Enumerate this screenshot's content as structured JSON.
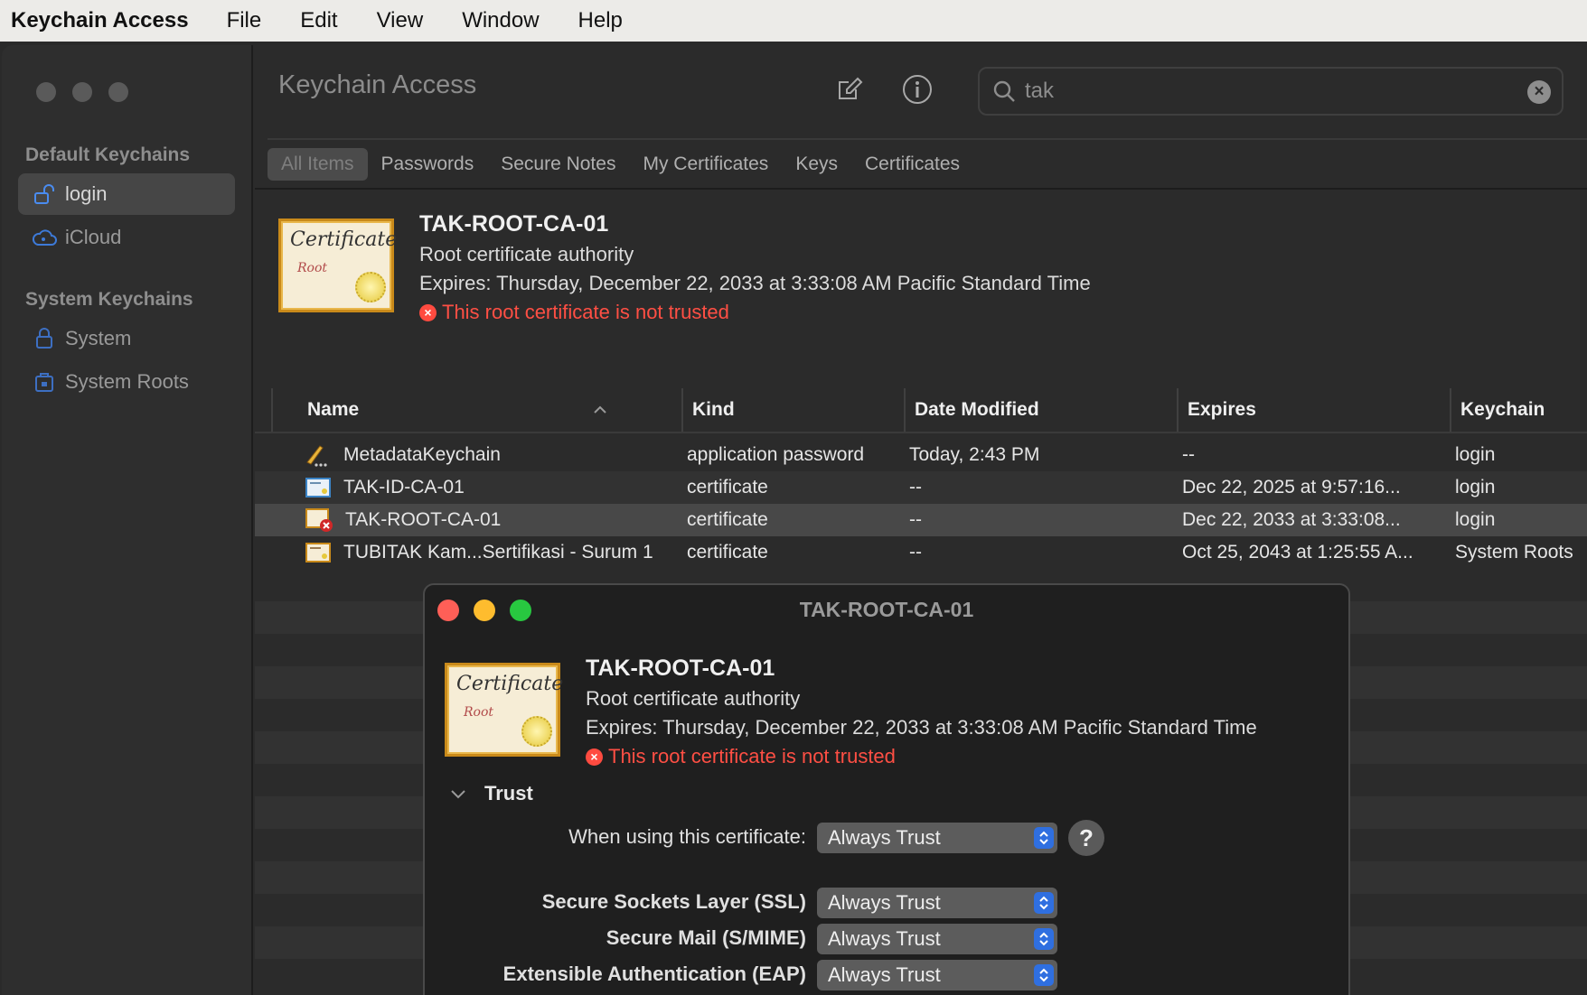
{
  "menubar": {
    "app_name": "Keychain Access",
    "items": [
      "File",
      "Edit",
      "View",
      "Window",
      "Help"
    ]
  },
  "sidebar": {
    "default_heading": "Default Keychains",
    "default_items": [
      {
        "label": "login",
        "icon": "unlocked-padlock-icon",
        "selected": true
      },
      {
        "label": "iCloud",
        "icon": "icloud-icon",
        "selected": false
      }
    ],
    "system_heading": "System Keychains",
    "system_items": [
      {
        "label": "System",
        "icon": "padlock-icon"
      },
      {
        "label": "System Roots",
        "icon": "cabinet-lock-icon"
      }
    ]
  },
  "toolbar": {
    "title": "Keychain Access",
    "search_value": "tak"
  },
  "tabs": [
    {
      "label": "All Items",
      "active": true
    },
    {
      "label": "Passwords",
      "active": false
    },
    {
      "label": "Secure Notes",
      "active": false
    },
    {
      "label": "My Certificates",
      "active": false
    },
    {
      "label": "Keys",
      "active": false
    },
    {
      "label": "Certificates",
      "active": false
    }
  ],
  "cert_icon_text": {
    "certificate": "Certificate",
    "root": "Root"
  },
  "summary": {
    "title": "TAK-ROOT-CA-01",
    "subtitle": "Root certificate authority",
    "expires": "Expires: Thursday, December 22, 2033 at 3:33:08 AM Pacific Standard Time",
    "warning": "This root certificate is not trusted"
  },
  "table": {
    "headers": [
      "Name",
      "Kind",
      "Date Modified",
      "Expires",
      "Keychain"
    ],
    "rows": [
      {
        "name": "MetadataKeychain",
        "kind": "application password",
        "modified": "Today, 2:43 PM",
        "expires": "--",
        "keychain": "login",
        "icon": "pencil-key-icon"
      },
      {
        "name": "TAK-ID-CA-01",
        "kind": "certificate",
        "modified": "--",
        "expires": "Dec 22, 2025 at 9:57:16...",
        "keychain": "login",
        "icon": "certificate-icon"
      },
      {
        "name": "TAK-ROOT-CA-01",
        "kind": "certificate",
        "modified": "--",
        "expires": "Dec 22, 2033 at 3:33:08...",
        "keychain": "login",
        "icon": "untrusted-certificate-icon",
        "selected": true
      },
      {
        "name": "TUBITAK Kam...Sertifikasi - Surum 1",
        "kind": "certificate",
        "modified": "--",
        "expires": "Oct 25, 2043 at 1:25:55 A...",
        "keychain": "System Roots",
        "icon": "root-certificate-icon"
      }
    ]
  },
  "dialog": {
    "title": "TAK-ROOT-CA-01",
    "summary": {
      "title": "TAK-ROOT-CA-01",
      "subtitle": "Root certificate authority",
      "expires": "Expires: Thursday, December 22, 2033 at 3:33:08 AM Pacific Standard Time",
      "warning": "This root certificate is not trusted"
    },
    "trust_heading": "Trust",
    "when_using_label": "When using this certificate:",
    "when_using_value": "Always Trust",
    "help_label": "?",
    "settings": [
      {
        "label": "Secure Sockets Layer (SSL)",
        "value": "Always Trust"
      },
      {
        "label": "Secure Mail (S/MIME)",
        "value": "Always Trust"
      },
      {
        "label": "Extensible Authentication (EAP)",
        "value": "Always Trust"
      }
    ]
  },
  "colors": {
    "untrusted_red": "#ff4f44",
    "popup_arrow_blue": "#2f6fe0",
    "close": "#ff5f57",
    "minimize": "#febc2e",
    "zoom": "#28c840"
  }
}
